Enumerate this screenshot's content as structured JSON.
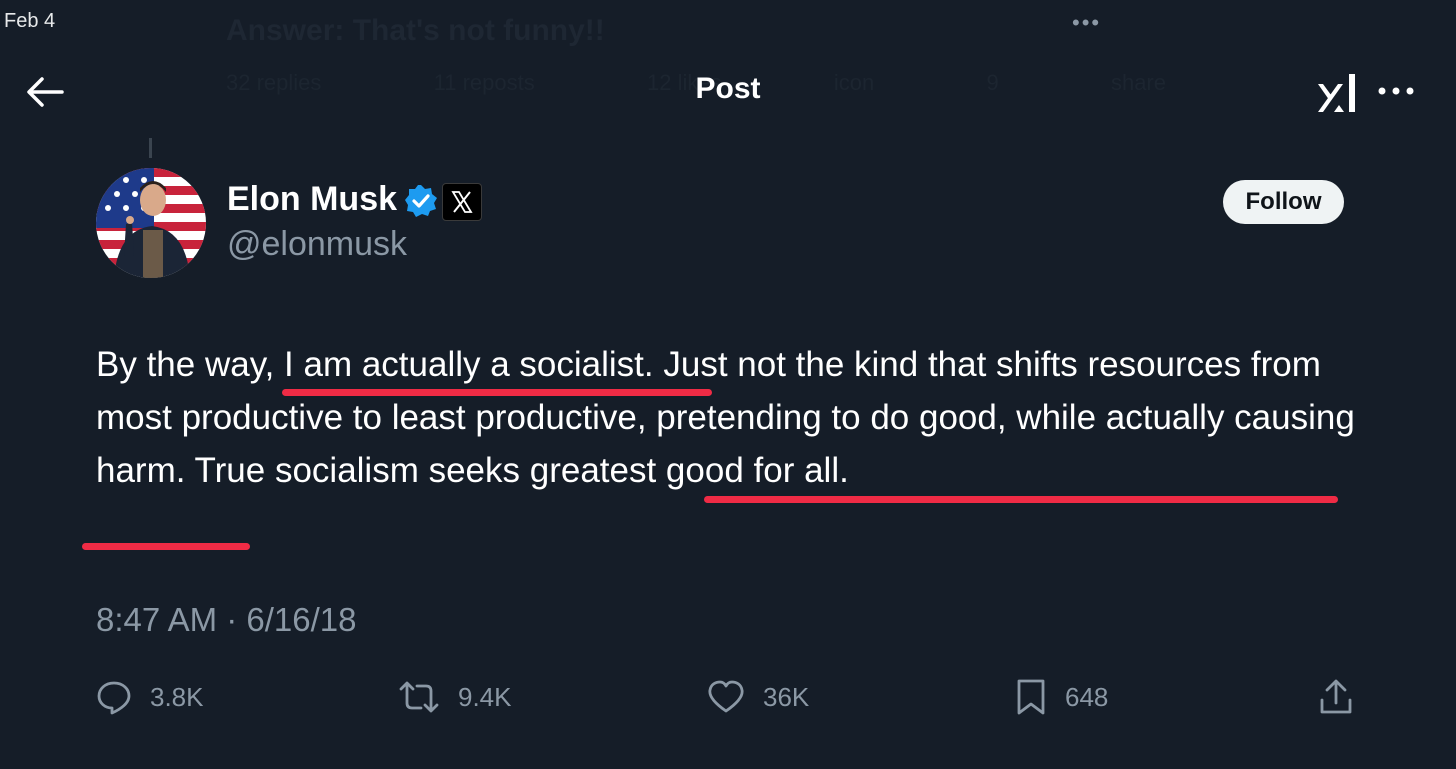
{
  "status_bar": {
    "date": "Feb 4",
    "dots": "•••"
  },
  "background_ghost": {
    "title": "Answer: That's not funny!!",
    "row": [
      "32 replies",
      "11 reposts",
      "12 likes",
      "icon",
      "9",
      "share"
    ]
  },
  "header": {
    "title": "Post"
  },
  "author": {
    "display_name": "Elon Musk",
    "handle": "@elonmusk",
    "follow_label": "Follow"
  },
  "post": {
    "text": "By the way, I am actually a socialist. Just not the kind that shifts resources from most productive to least productive, pretending to do good, while actually causing harm. True socialism seeks greatest good for all.",
    "timestamp": "8:47 AM · 6/16/18"
  },
  "actions": {
    "replies": "3.8K",
    "reposts": "9.4K",
    "likes": "36K",
    "bookmarks": "648"
  },
  "icons": {
    "back": "arrow-left-icon",
    "logo": "xai-logo",
    "more": "more-horizontal-icon",
    "verified": "verified-badge-icon",
    "affiliation": "x-logo-icon",
    "reply": "reply-icon",
    "repost": "repost-icon",
    "like": "heart-icon",
    "bookmark": "bookmark-icon",
    "share": "share-icon"
  },
  "colors": {
    "background": "#151d28",
    "text": "#ffffff",
    "secondary_text": "#8b98a5",
    "verified": "#1d9bf0",
    "highlight_underline": "#ef2b45",
    "follow_button": "#eff3f4"
  }
}
